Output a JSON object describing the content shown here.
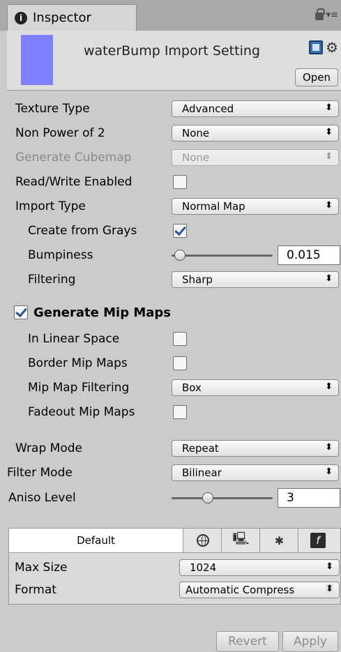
{
  "tab": {
    "title": "Inspector",
    "info_icon": "info-icon",
    "lock_icon": "lock-icon",
    "menu_glyph": "▾≡"
  },
  "header": {
    "title": "waterBump Import Setting",
    "open_label": "Open",
    "thumbnail_color": "#8080ff"
  },
  "fields": {
    "texture_type": {
      "label": "Texture Type",
      "value": "Advanced"
    },
    "non_power_of_2": {
      "label": "Non Power of 2",
      "value": "None"
    },
    "generate_cubemap": {
      "label": "Generate Cubemap",
      "value": "None"
    },
    "read_write": {
      "label": "Read/Write Enabled",
      "checked": false
    },
    "import_type": {
      "label": "Import Type",
      "value": "Normal Map"
    },
    "create_from_grays": {
      "label": "Create from Grays",
      "checked": true
    },
    "bumpiness": {
      "label": "Bumpiness",
      "value": "0.015"
    },
    "filtering": {
      "label": "Filtering",
      "value": "Sharp"
    },
    "generate_mip_maps": {
      "label": "Generate Mip Maps",
      "checked": true
    },
    "in_linear_space": {
      "label": "In Linear Space",
      "checked": false
    },
    "border_mip_maps": {
      "label": "Border Mip Maps",
      "checked": false
    },
    "mip_map_filtering": {
      "label": "Mip Map Filtering",
      "value": "Box"
    },
    "fadeout_mip_maps": {
      "label": "Fadeout Mip Maps",
      "checked": false
    },
    "wrap_mode": {
      "label": "Wrap Mode",
      "value": "Repeat"
    },
    "filter_mode": {
      "label": "Filter Mode",
      "value": "Bilinear"
    },
    "aniso_level": {
      "label": "Aniso Level",
      "value": "3"
    }
  },
  "platform": {
    "default_label": "Default",
    "icons": [
      "globe-icon",
      "standalone-icon",
      "android-icon",
      "flash-icon"
    ],
    "max_size": {
      "label": "Max Size",
      "value": "1024"
    },
    "format": {
      "label": "Format",
      "value": "Automatic Compress"
    }
  },
  "footer": {
    "revert_label": "Revert",
    "apply_label": "Apply"
  },
  "dropdown_arrow": "⬍"
}
